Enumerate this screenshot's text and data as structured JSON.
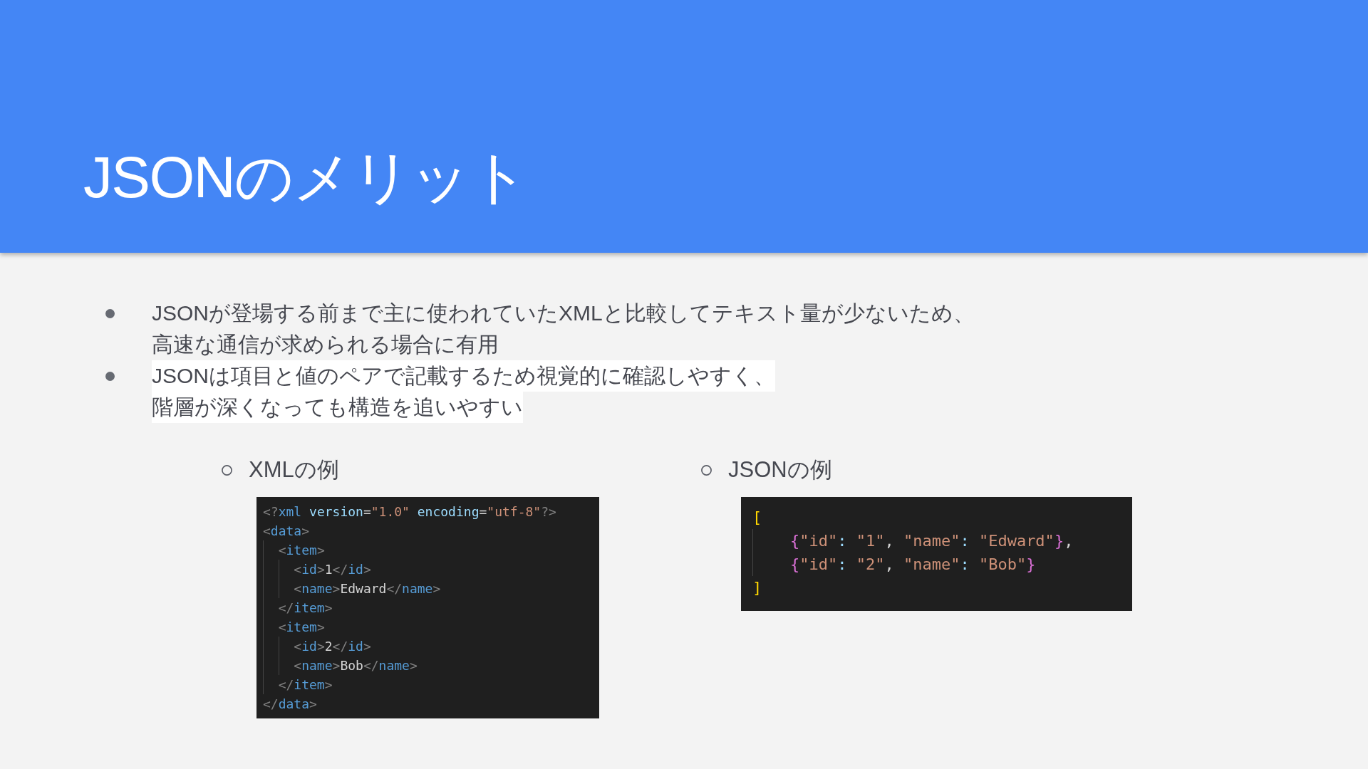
{
  "header": {
    "title": "JSONのメリット"
  },
  "bullets": [
    {
      "lines": [
        "JSONが登場する前まで主に使われていたXMLと比較してテキスト量が少ないため、",
        "高速な通信が求められる場合に有用"
      ],
      "highlighted": false
    },
    {
      "lines": [
        "JSONは項目と値のペアで記載するため視覚的に確認しやすく、",
        "階層が深くなっても構造を追いやすい"
      ],
      "highlighted": true
    }
  ],
  "examples": [
    {
      "heading": "XMLの例",
      "code": {
        "lines": [
          {
            "tokens": [
              {
                "kind": "delim",
                "text": "<?"
              },
              {
                "kind": "tag",
                "text": "xml"
              },
              {
                "kind": "attr",
                "text": " version"
              },
              {
                "kind": "punct",
                "text": "="
              },
              {
                "kind": "string",
                "text": "\"1.0\""
              },
              {
                "kind": "attr",
                "text": " encoding"
              },
              {
                "kind": "punct",
                "text": "="
              },
              {
                "kind": "string",
                "text": "\"utf-8\""
              },
              {
                "kind": "delim",
                "text": "?>"
              }
            ]
          },
          {
            "tokens": [
              {
                "kind": "delim",
                "text": "<"
              },
              {
                "kind": "tag",
                "text": "data"
              },
              {
                "kind": "delim",
                "text": ">"
              }
            ],
            "children": [
              {
                "tokens": [
                  {
                    "kind": "delim",
                    "text": "<"
                  },
                  {
                    "kind": "tag",
                    "text": "item"
                  },
                  {
                    "kind": "delim",
                    "text": ">"
                  }
                ],
                "children": [
                  {
                    "tokens": [
                      {
                        "kind": "delim",
                        "text": "<"
                      },
                      {
                        "kind": "tag",
                        "text": "id"
                      },
                      {
                        "kind": "delim",
                        "text": ">"
                      },
                      {
                        "kind": "text",
                        "text": "1"
                      },
                      {
                        "kind": "delim",
                        "text": "</"
                      },
                      {
                        "kind": "tag",
                        "text": "id"
                      },
                      {
                        "kind": "delim",
                        "text": ">"
                      }
                    ]
                  },
                  {
                    "tokens": [
                      {
                        "kind": "delim",
                        "text": "<"
                      },
                      {
                        "kind": "tag",
                        "text": "name"
                      },
                      {
                        "kind": "delim",
                        "text": ">"
                      },
                      {
                        "kind": "text",
                        "text": "Edward"
                      },
                      {
                        "kind": "delim",
                        "text": "</"
                      },
                      {
                        "kind": "tag",
                        "text": "name"
                      },
                      {
                        "kind": "delim",
                        "text": ">"
                      }
                    ]
                  }
                ]
              },
              {
                "tokens": [
                  {
                    "kind": "delim",
                    "text": "</"
                  },
                  {
                    "kind": "tag",
                    "text": "item"
                  },
                  {
                    "kind": "delim",
                    "text": ">"
                  }
                ]
              },
              {
                "tokens": [
                  {
                    "kind": "delim",
                    "text": "<"
                  },
                  {
                    "kind": "tag",
                    "text": "item"
                  },
                  {
                    "kind": "delim",
                    "text": ">"
                  }
                ],
                "children": [
                  {
                    "tokens": [
                      {
                        "kind": "delim",
                        "text": "<"
                      },
                      {
                        "kind": "tag",
                        "text": "id"
                      },
                      {
                        "kind": "delim",
                        "text": ">"
                      },
                      {
                        "kind": "text",
                        "text": "2"
                      },
                      {
                        "kind": "delim",
                        "text": "</"
                      },
                      {
                        "kind": "tag",
                        "text": "id"
                      },
                      {
                        "kind": "delim",
                        "text": ">"
                      }
                    ]
                  },
                  {
                    "tokens": [
                      {
                        "kind": "delim",
                        "text": "<"
                      },
                      {
                        "kind": "tag",
                        "text": "name"
                      },
                      {
                        "kind": "delim",
                        "text": ">"
                      },
                      {
                        "kind": "text",
                        "text": "Bob"
                      },
                      {
                        "kind": "delim",
                        "text": "</"
                      },
                      {
                        "kind": "tag",
                        "text": "name"
                      },
                      {
                        "kind": "delim",
                        "text": ">"
                      }
                    ]
                  }
                ]
              },
              {
                "tokens": [
                  {
                    "kind": "delim",
                    "text": "</"
                  },
                  {
                    "kind": "tag",
                    "text": "item"
                  },
                  {
                    "kind": "delim",
                    "text": ">"
                  }
                ]
              }
            ]
          },
          {
            "tokens": [
              {
                "kind": "delim",
                "text": "</"
              },
              {
                "kind": "tag",
                "text": "data"
              },
              {
                "kind": "delim",
                "text": ">"
              }
            ]
          }
        ]
      }
    },
    {
      "heading": "JSONの例",
      "code": {
        "lines": [
          {
            "tokens": [
              {
                "kind": "bracket",
                "text": "["
              }
            ],
            "children": [
              {
                "tokens": [
                  {
                    "kind": "brace",
                    "text": "{"
                  },
                  {
                    "kind": "string",
                    "text": "\"id\""
                  },
                  {
                    "kind": "colon",
                    "text": ":"
                  },
                  {
                    "kind": "string",
                    "text": " \"1\""
                  },
                  {
                    "kind": "punct",
                    "text": ","
                  },
                  {
                    "kind": "string",
                    "text": " \"name\""
                  },
                  {
                    "kind": "colon",
                    "text": ":"
                  },
                  {
                    "kind": "string",
                    "text": " \"Edward\""
                  },
                  {
                    "kind": "brace",
                    "text": "}"
                  },
                  {
                    "kind": "punct",
                    "text": ","
                  }
                ]
              },
              {
                "tokens": [
                  {
                    "kind": "brace",
                    "text": "{"
                  },
                  {
                    "kind": "string",
                    "text": "\"id\""
                  },
                  {
                    "kind": "colon",
                    "text": ":"
                  },
                  {
                    "kind": "string",
                    "text": " \"2\""
                  },
                  {
                    "kind": "punct",
                    "text": ","
                  },
                  {
                    "kind": "string",
                    "text": " \"name\""
                  },
                  {
                    "kind": "colon",
                    "text": ":"
                  },
                  {
                    "kind": "string",
                    "text": " \"Bob\""
                  },
                  {
                    "kind": "brace",
                    "text": "}"
                  }
                ]
              }
            ]
          },
          {
            "tokens": [
              {
                "kind": "bracket",
                "text": "]"
              }
            ]
          }
        ]
      }
    }
  ]
}
